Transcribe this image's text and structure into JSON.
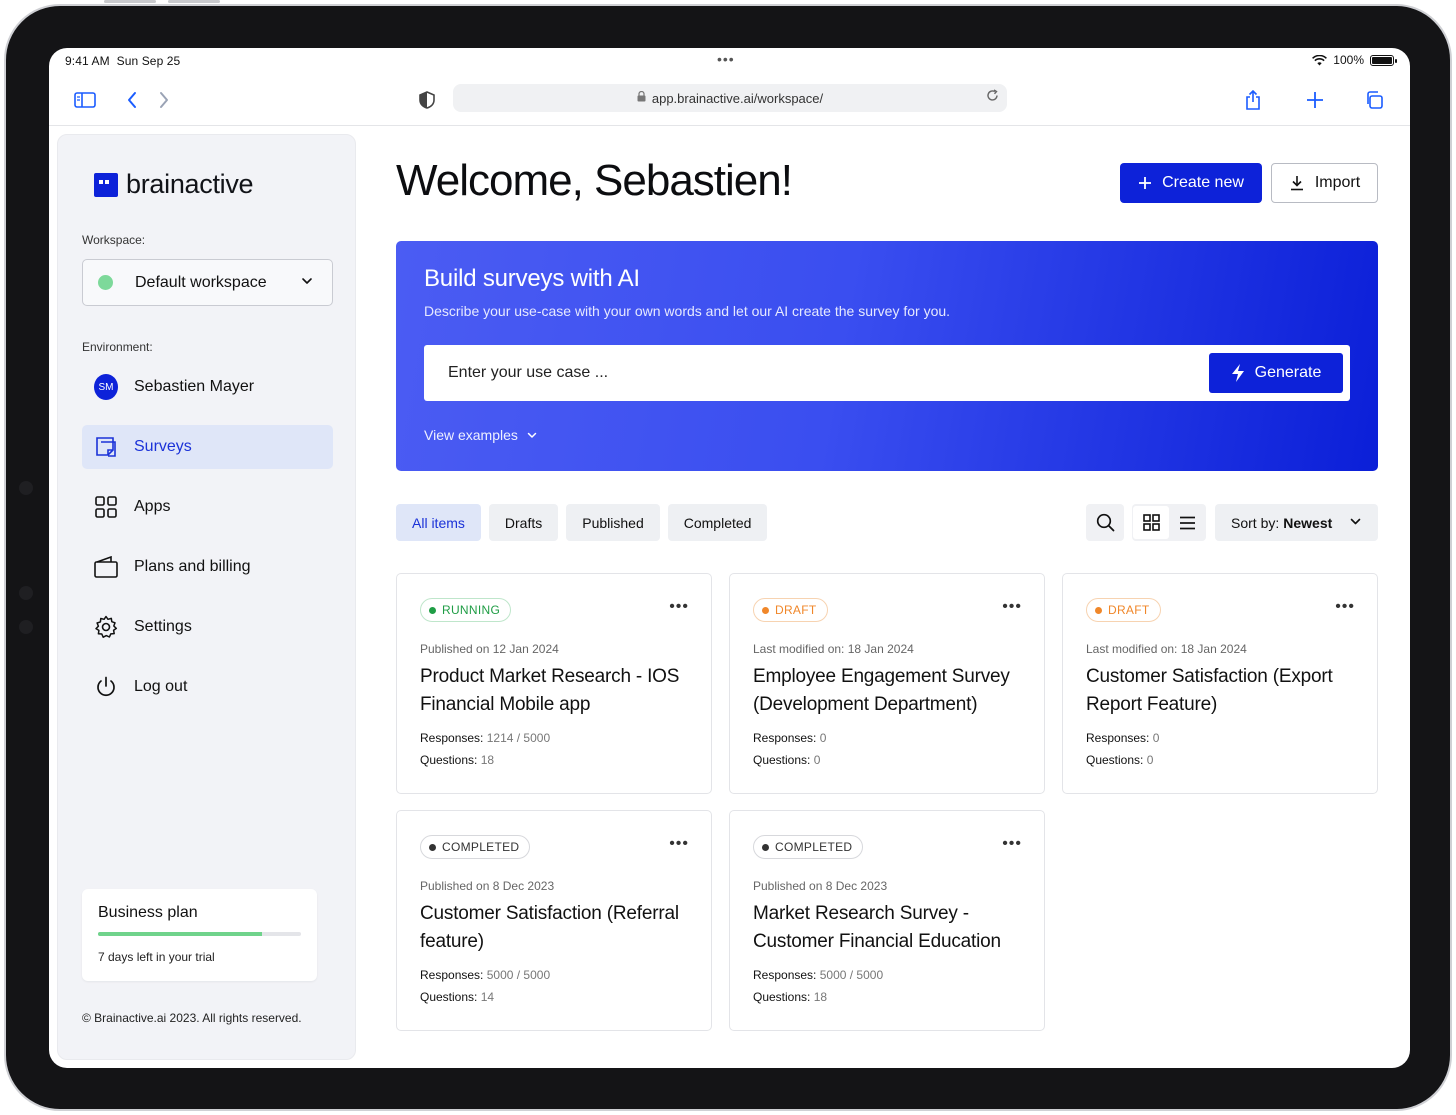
{
  "status_bar": {
    "time": "9:41 AM",
    "date": "Sun Sep 25",
    "battery": "100%"
  },
  "browser": {
    "url": "app.brainactive.ai/workspace/"
  },
  "brand": {
    "name": "brainactive",
    "color": "#0d22d9"
  },
  "sidebar": {
    "workspace_label": "Workspace:",
    "workspace_value": "Default workspace",
    "environment_label": "Environment:",
    "user_initials": "SM",
    "user_name": "Sebastien Mayer",
    "items": [
      {
        "label": "Surveys",
        "icon": "surveys-icon",
        "active": true
      },
      {
        "label": "Apps",
        "icon": "apps-icon",
        "active": false
      },
      {
        "label": "Plans and billing",
        "icon": "wallet-icon",
        "active": false
      },
      {
        "label": "Settings",
        "icon": "gear-icon",
        "active": false
      },
      {
        "label": "Log out",
        "icon": "power-icon",
        "active": false
      }
    ],
    "plan": {
      "title": "Business plan",
      "progress": 0.81,
      "subtitle": "7 days left in your trial"
    },
    "copyright": "© Brainactive.ai 2023. All rights reserved."
  },
  "main": {
    "welcome": "Welcome, Sebastien!",
    "create_label": "Create new",
    "import_label": "Import",
    "hero": {
      "title": "Build surveys with AI",
      "subtitle": "Describe your use-case with your own words and let our AI create the survey for you.",
      "placeholder": "Enter your use case ...",
      "generate_label": "Generate",
      "examples_label": "View examples"
    },
    "tabs": [
      {
        "label": "All items",
        "active": true
      },
      {
        "label": "Drafts",
        "active": false
      },
      {
        "label": "Published",
        "active": false
      },
      {
        "label": "Completed",
        "active": false
      }
    ],
    "sort_label": "Sort by:",
    "sort_value": "Newest",
    "cards": [
      {
        "status": "RUNNING",
        "status_color": "#1f9d45",
        "status_border": "#bfe6cb",
        "date_label": "Published on",
        "date": "12 Jan 2024",
        "title": "Product Market Research - IOS Financial Mobile app",
        "responses_label": "Responses:",
        "responses": "1214 / 5000",
        "questions_label": "Questions:",
        "questions": "18"
      },
      {
        "status": "DRAFT",
        "status_color": "#f0872a",
        "status_border": "#f7d3b1",
        "date_label": "Last modified on:",
        "date": "18 Jan 2024",
        "title": "Employee Engagement Survey (Development Department)",
        "responses_label": "Responses:",
        "responses": "0",
        "questions_label": "Questions:",
        "questions": "0"
      },
      {
        "status": "DRAFT",
        "status_color": "#f0872a",
        "status_border": "#f7d3b1",
        "date_label": "Last modified on:",
        "date": "18 Jan 2024",
        "title": "Customer Satisfaction (Export Report Feature)",
        "responses_label": "Responses:",
        "responses": "0",
        "questions_label": "Questions:",
        "questions": "0"
      },
      {
        "status": "COMPLETED",
        "status_color": "#333333",
        "status_border": "#d7d8dc",
        "date_label": "Published on",
        "date": "8 Dec 2023",
        "title": "Customer Satisfaction (Referral feature)",
        "responses_label": "Responses:",
        "responses": "5000 / 5000",
        "questions_label": "Questions:",
        "questions": "14"
      },
      {
        "status": "COMPLETED",
        "status_color": "#333333",
        "status_border": "#d7d8dc",
        "date_label": "Published on",
        "date": "8 Dec 2023",
        "title": "Market Research Survey - Customer Financial Education",
        "responses_label": "Responses:",
        "responses": "5000 / 5000",
        "questions_label": "Questions:",
        "questions": "18"
      }
    ]
  }
}
